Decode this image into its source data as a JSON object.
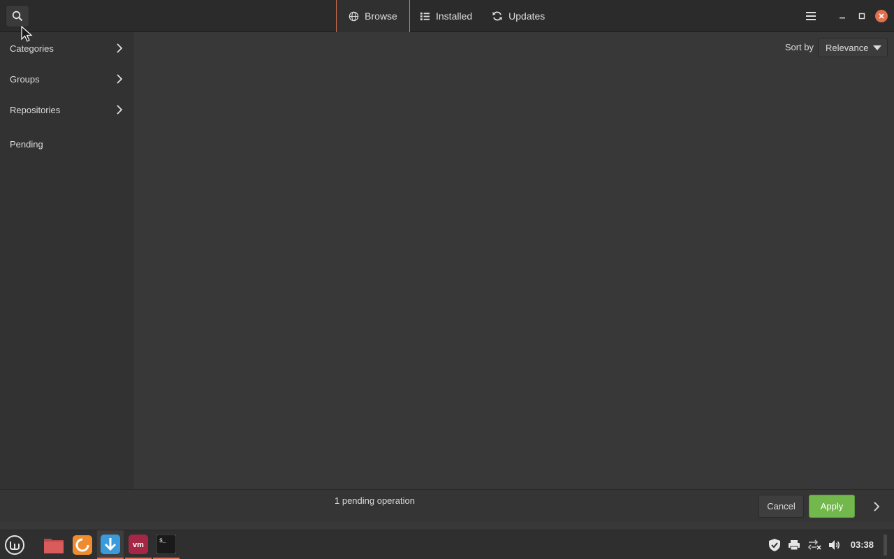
{
  "window": {
    "tabs": [
      {
        "label": "Browse",
        "icon": "globe-icon",
        "active": true
      },
      {
        "label": "Installed",
        "icon": "list-icon",
        "active": false
      },
      {
        "label": "Updates",
        "icon": "refresh-icon",
        "active": false
      }
    ]
  },
  "sidebar": {
    "items": [
      {
        "label": "Categories",
        "has_children": true
      },
      {
        "label": "Groups",
        "has_children": true
      },
      {
        "label": "Repositories",
        "has_children": true
      },
      {
        "label": "Pending",
        "has_children": false
      }
    ]
  },
  "main": {
    "sort_label": "Sort by",
    "sort_value": "Relevance"
  },
  "actionbar": {
    "pending_text": "1 pending operation",
    "cancel_label": "Cancel",
    "apply_label": "Apply"
  },
  "taskbar": {
    "launchers": [
      {
        "name": "files-icon"
      },
      {
        "name": "firefox-icon"
      },
      {
        "name": "software-manager-icon"
      },
      {
        "name": "vmware-icon"
      },
      {
        "name": "terminal-icon"
      }
    ],
    "clock": "03:38"
  },
  "colors": {
    "accent": "#e2704e",
    "apply_green": "#72b84c",
    "background": "#383838",
    "sidebar": "#323232",
    "headerbar": "#2b2b2b"
  }
}
